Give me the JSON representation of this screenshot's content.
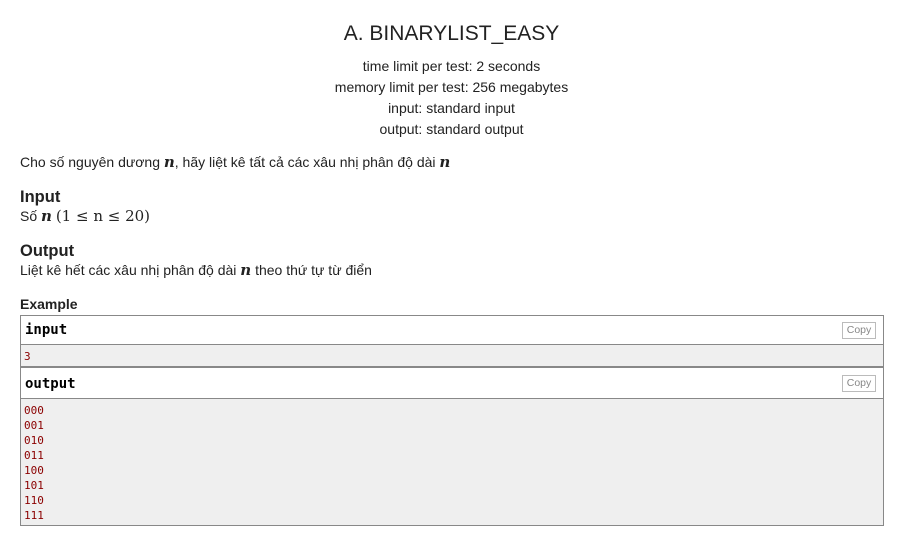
{
  "problem": {
    "title": "A. BINARYLIST_EASY",
    "time_limit": "time limit per test: 2 seconds",
    "memory_limit": "memory limit per test: 256 megabytes",
    "input_file": "input: standard input",
    "output_file": "output: standard output"
  },
  "legend": {
    "before": "Cho số nguyên dương ",
    "var1": "n",
    "middle": ", hãy liệt kê tất cả các xâu nhị phân độ dài ",
    "var2": "n"
  },
  "input_spec": {
    "title": "Input",
    "text_before": "Số ",
    "var": "n",
    "constraint": "(1 ≤ n ≤ 20)"
  },
  "output_spec": {
    "title": "Output",
    "text_before": "Liệt kê hết các xâu nhị phân độ dài ",
    "var": "n",
    "text_after": " theo thứ tự từ điển"
  },
  "example": {
    "title": "Example",
    "input_label": "input",
    "output_label": "output",
    "copy_label": "Copy",
    "input_lines": [
      "3"
    ],
    "output_lines": [
      "000",
      "001",
      "010",
      "011",
      "100",
      "101",
      "110",
      "111"
    ]
  },
  "colors": {
    "pre_text": "#8b0000",
    "pre_background": "#efefef",
    "border": "#888888"
  }
}
